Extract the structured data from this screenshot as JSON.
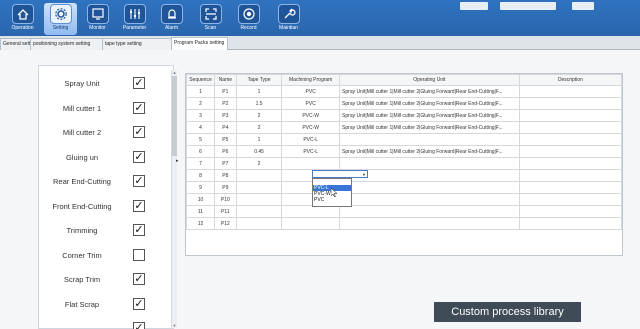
{
  "toolbar": {
    "buttons": [
      {
        "label": "Operation",
        "icon": "home-icon",
        "active": false
      },
      {
        "label": "Setting",
        "icon": "gear-icon",
        "active": true
      },
      {
        "label": "Monitor",
        "icon": "monitor-icon",
        "active": false
      },
      {
        "label": "Parameter",
        "icon": "sliders-icon",
        "active": false
      },
      {
        "label": "Alarm",
        "icon": "alarm-icon",
        "active": false
      },
      {
        "label": "Scan",
        "icon": "scan-icon",
        "active": false
      },
      {
        "label": "Record",
        "icon": "record-icon",
        "active": false
      },
      {
        "label": "Maintian",
        "icon": "wrench-icon",
        "active": false
      }
    ]
  },
  "tabs": [
    {
      "label": "General setting",
      "active": false
    },
    {
      "label": "positioning system setting",
      "active": false
    },
    {
      "label": "tape type setting",
      "active": false
    },
    {
      "label": "Program Packs setting",
      "active": true
    }
  ],
  "units": [
    {
      "name": "Spray Unit",
      "checked": true
    },
    {
      "name": "Mill cutter 1",
      "checked": true
    },
    {
      "name": "Mill cutter 2",
      "checked": true
    },
    {
      "name": "Gluing un",
      "checked": true
    },
    {
      "name": "Rear End-Cutting",
      "checked": true
    },
    {
      "name": "Front End-Cutting",
      "checked": true
    },
    {
      "name": "Trimming",
      "checked": true
    },
    {
      "name": "Corner Trim",
      "checked": false
    },
    {
      "name": "Scrap Trim",
      "checked": true
    },
    {
      "name": "Flat Scrap",
      "checked": true
    }
  ],
  "table": {
    "headers": [
      "Sequence",
      "Name",
      "Tape Type",
      "Machining Program",
      "Operating Unit",
      "Description"
    ],
    "rows": [
      [
        "1",
        "P1",
        "1",
        "PVC",
        "Spray Unit|Mill cutter 1|Mill cutter 2|Gluing Forward|Rear End-Cutting|F...",
        ""
      ],
      [
        "2",
        "P2",
        "1.5",
        "PVC",
        "Spray Unit|Mill cutter 1|Mill cutter 2|Gluing Forward|Rear End-Cutting|F...",
        ""
      ],
      [
        "3",
        "P3",
        "2",
        "PVC-W",
        "Spray Unit|Mill cutter 1|Mill cutter 2|Gluing Forward|Rear End-Cutting|F...",
        ""
      ],
      [
        "4",
        "P4",
        "2",
        "PVC-W",
        "Spray Unit|Mill cutter 1|Mill cutter 2|Gluing Forward|Rear End-Cutting|F...",
        ""
      ],
      [
        "5",
        "P5",
        "1",
        "PVC-L",
        "",
        ""
      ],
      [
        "6",
        "P6",
        "0.45",
        "PVC-L",
        "Spray Unit|Mill cutter 1|Mill cutter 2|Gluing Forward|Rear End-Cutting|F...",
        ""
      ],
      [
        "7",
        "P7",
        "2",
        "",
        "",
        ""
      ],
      [
        "8",
        "P8",
        "",
        "",
        "",
        ""
      ],
      [
        "9",
        "P9",
        "",
        "",
        "",
        ""
      ],
      [
        "10",
        "P10",
        "",
        "",
        "",
        ""
      ],
      [
        "11",
        "P11",
        "",
        "",
        "",
        ""
      ],
      [
        "12",
        "P12",
        "",
        "",
        "",
        ""
      ]
    ]
  },
  "dropdown": {
    "options": [
      "PVC-L",
      "PVC-W",
      "PVC"
    ],
    "highlighted": "PVC-L"
  },
  "caption": "Custom process library",
  "colors": {
    "toolbar": "#2f73c0",
    "highlight": "#3875d7",
    "caption_bg": "#3f4b57"
  }
}
